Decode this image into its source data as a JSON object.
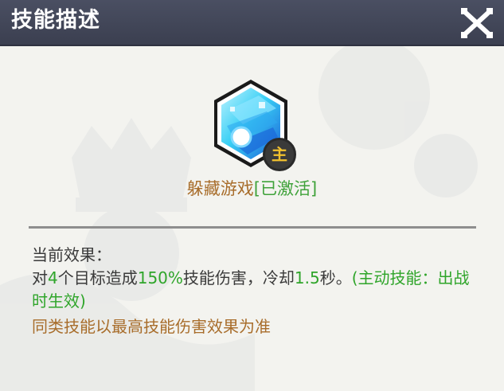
{
  "dialog": {
    "title": "技能描述",
    "close_icon": "close-x-icon"
  },
  "skill": {
    "icon": "blue-crystal-hexagon-icon",
    "role_badge": "主",
    "name": "躲藏游戏",
    "status": "[已激活]"
  },
  "effect": {
    "header": "当前效果：",
    "desc_part1": "对",
    "desc_targets": "4",
    "desc_part2": "个目标造成",
    "desc_percent": "150%",
    "desc_part3": "技能伤害，冷却",
    "desc_cooldown": "1.5",
    "desc_part4": "秒。",
    "desc_note": "(主动技能：出战时生效)",
    "rule": "同类技能以最高技能伤害效果为准"
  },
  "colors": {
    "header_bg": "#3f4355",
    "panel_bg": "#f3f3ef",
    "highlight_green": "#2fa52a",
    "name_brown": "#a86d2b",
    "badge_gold": "#f2c12e"
  }
}
